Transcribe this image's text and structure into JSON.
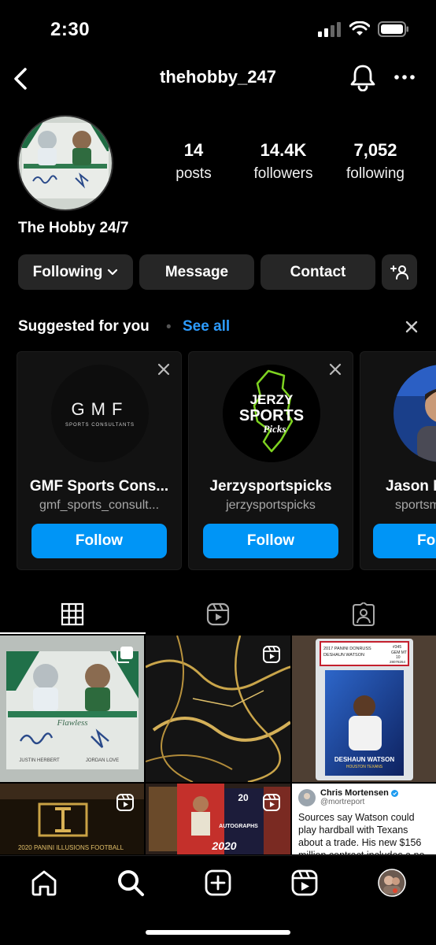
{
  "status_bar": {
    "time": "2:30"
  },
  "header": {
    "username": "thehobby_247"
  },
  "profile": {
    "display_name": "The Hobby 24/7",
    "stats": [
      {
        "value": "14",
        "label": "posts"
      },
      {
        "value": "14.4K",
        "label": "followers"
      },
      {
        "value": "7,052",
        "label": "following"
      }
    ],
    "avatar_card": {
      "brand": "Flawless",
      "player_left": "JUSTIN HERBERT",
      "player_right": "JORDAN LOVE"
    }
  },
  "actions": {
    "following_label": "Following",
    "message_label": "Message",
    "contact_label": "Contact"
  },
  "suggested": {
    "title": "Suggested for you",
    "see_all": "See all",
    "cards": [
      {
        "name": "GMF Sports Cons...",
        "handle": "gmf_sports_consult...",
        "follow_label": "Follow",
        "logo_text": "GMF",
        "logo_sub": "SPORTS CONSULTANTS"
      },
      {
        "name": "Jerzysportspicks",
        "handle": "jerzysportspicks",
        "follow_label": "Follow",
        "logo_line1": "JERZY",
        "logo_line2": "SPORTS",
        "logo_line3": "Picks"
      },
      {
        "name": "Jason M",
        "handle": "sportsm",
        "follow_label": "Fo"
      }
    ]
  },
  "grid": {
    "psa": {
      "line1": "2017 PANINI DONRUSS",
      "line2": "DESHAUN WATSON",
      "grade_no": "#345",
      "grade": "GEM MT",
      "grade_num": "10",
      "cert": "28078264",
      "card_name": "DESHAUN WATSON",
      "card_team": "HOUSTON TEXANS"
    },
    "card1": {
      "brand": "Flawless",
      "left": "JUSTIN HERBERT",
      "right": "JORDAN LOVE"
    },
    "illusions": "2020 PANINI ILLUSIONS FOOTBALL",
    "mosaic": {
      "year": "2020",
      "text": "AUTOGRAPHS",
      "num": "20"
    },
    "tweet": {
      "name": "Chris Mortensen",
      "handle": "@mortreport",
      "text": "Sources say Watson could play hardball with Texans about a trade. His new $156 million contract includes a no-trade clause but"
    }
  },
  "colors": {
    "accent": "#0095f6",
    "link": "#2d9cff",
    "button_bg": "#262626",
    "background": "#000000"
  }
}
